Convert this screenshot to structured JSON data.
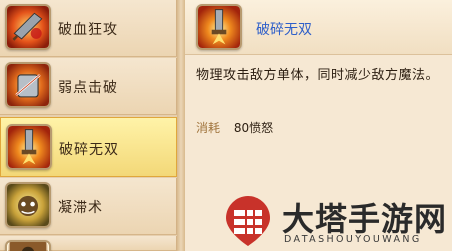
{
  "skills": [
    {
      "label": "破血狂攻",
      "icon": "blood-strike-icon",
      "selected": false
    },
    {
      "label": "弱点击破",
      "icon": "weak-point-icon",
      "selected": false
    },
    {
      "label": "破碎无双",
      "icon": "shatter-icon",
      "selected": true
    },
    {
      "label": "凝滞术",
      "icon": "stagnation-icon",
      "selected": false
    },
    {
      "label": "",
      "icon": "partial-skill-icon",
      "selected": false
    }
  ],
  "detail": {
    "name": "破碎无双",
    "icon": "shatter-icon",
    "description": "物理攻击敌方单体，同时减少敌方魔法。",
    "cost_label": "消耗",
    "cost_value": "80愤怒"
  },
  "watermark": {
    "title": "大塔手游网",
    "subtitle": "DATASHOUYOUWANG"
  },
  "colors": {
    "skill_name_highlight": "#2e5fc9",
    "selected_row": "#f9e07f",
    "panel_background": "#f6e8d3"
  }
}
